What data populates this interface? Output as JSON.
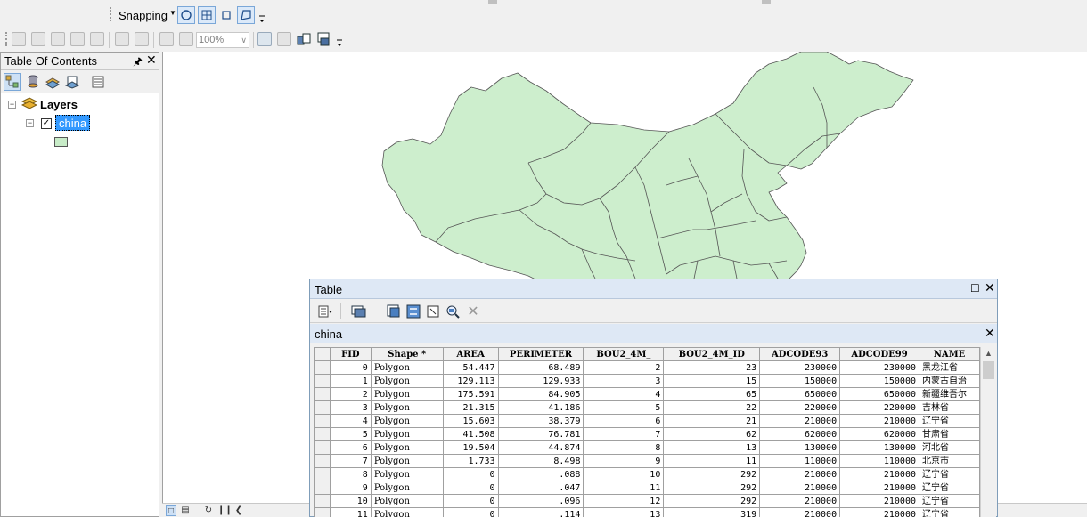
{
  "snapping_toolbar": {
    "label": "Snapping"
  },
  "zoom_toolbar": {
    "zoom_value": "100%"
  },
  "toc": {
    "title": "Table Of Contents",
    "root_label": "Layers",
    "layer_name": "china",
    "legend_fill_color": "#c8ecc8"
  },
  "map": {
    "fill_color": "#cdeecd",
    "stroke_color": "#555555"
  },
  "table_window": {
    "title": "Table",
    "tab_label": "china",
    "columns": [
      "FID",
      "Shape *",
      "AREA",
      "PERIMETER",
      "BOU2_4M_",
      "BOU2_4M_ID",
      "ADCODE93",
      "ADCODE99",
      "NAME"
    ],
    "rows": [
      [
        "0",
        "Polygon",
        "54.447",
        "68.489",
        "2",
        "23",
        "230000",
        "230000",
        "黑龙江省"
      ],
      [
        "1",
        "Polygon",
        "129.113",
        "129.933",
        "3",
        "15",
        "150000",
        "150000",
        "内蒙古自治"
      ],
      [
        "2",
        "Polygon",
        "175.591",
        "84.905",
        "4",
        "65",
        "650000",
        "650000",
        "新疆维吾尔"
      ],
      [
        "3",
        "Polygon",
        "21.315",
        "41.186",
        "5",
        "22",
        "220000",
        "220000",
        "吉林省"
      ],
      [
        "4",
        "Polygon",
        "15.603",
        "38.379",
        "6",
        "21",
        "210000",
        "210000",
        "辽宁省"
      ],
      [
        "5",
        "Polygon",
        "41.508",
        "76.781",
        "7",
        "62",
        "620000",
        "620000",
        "甘肃省"
      ],
      [
        "6",
        "Polygon",
        "19.504",
        "44.874",
        "8",
        "13",
        "130000",
        "130000",
        "河北省"
      ],
      [
        "7",
        "Polygon",
        "1.733",
        "8.498",
        "9",
        "11",
        "110000",
        "110000",
        "北京市"
      ],
      [
        "8",
        "Polygon",
        "0",
        ".088",
        "10",
        "292",
        "210000",
        "210000",
        "辽宁省"
      ],
      [
        "9",
        "Polygon",
        "0",
        ".047",
        "11",
        "292",
        "210000",
        "210000",
        "辽宁省"
      ],
      [
        "10",
        "Polygon",
        "0",
        ".096",
        "12",
        "292",
        "210000",
        "210000",
        "辽宁省"
      ],
      [
        "11",
        "Polygon",
        "0",
        ".114",
        "13",
        "319",
        "210000",
        "210000",
        "辽宁省"
      ]
    ]
  }
}
